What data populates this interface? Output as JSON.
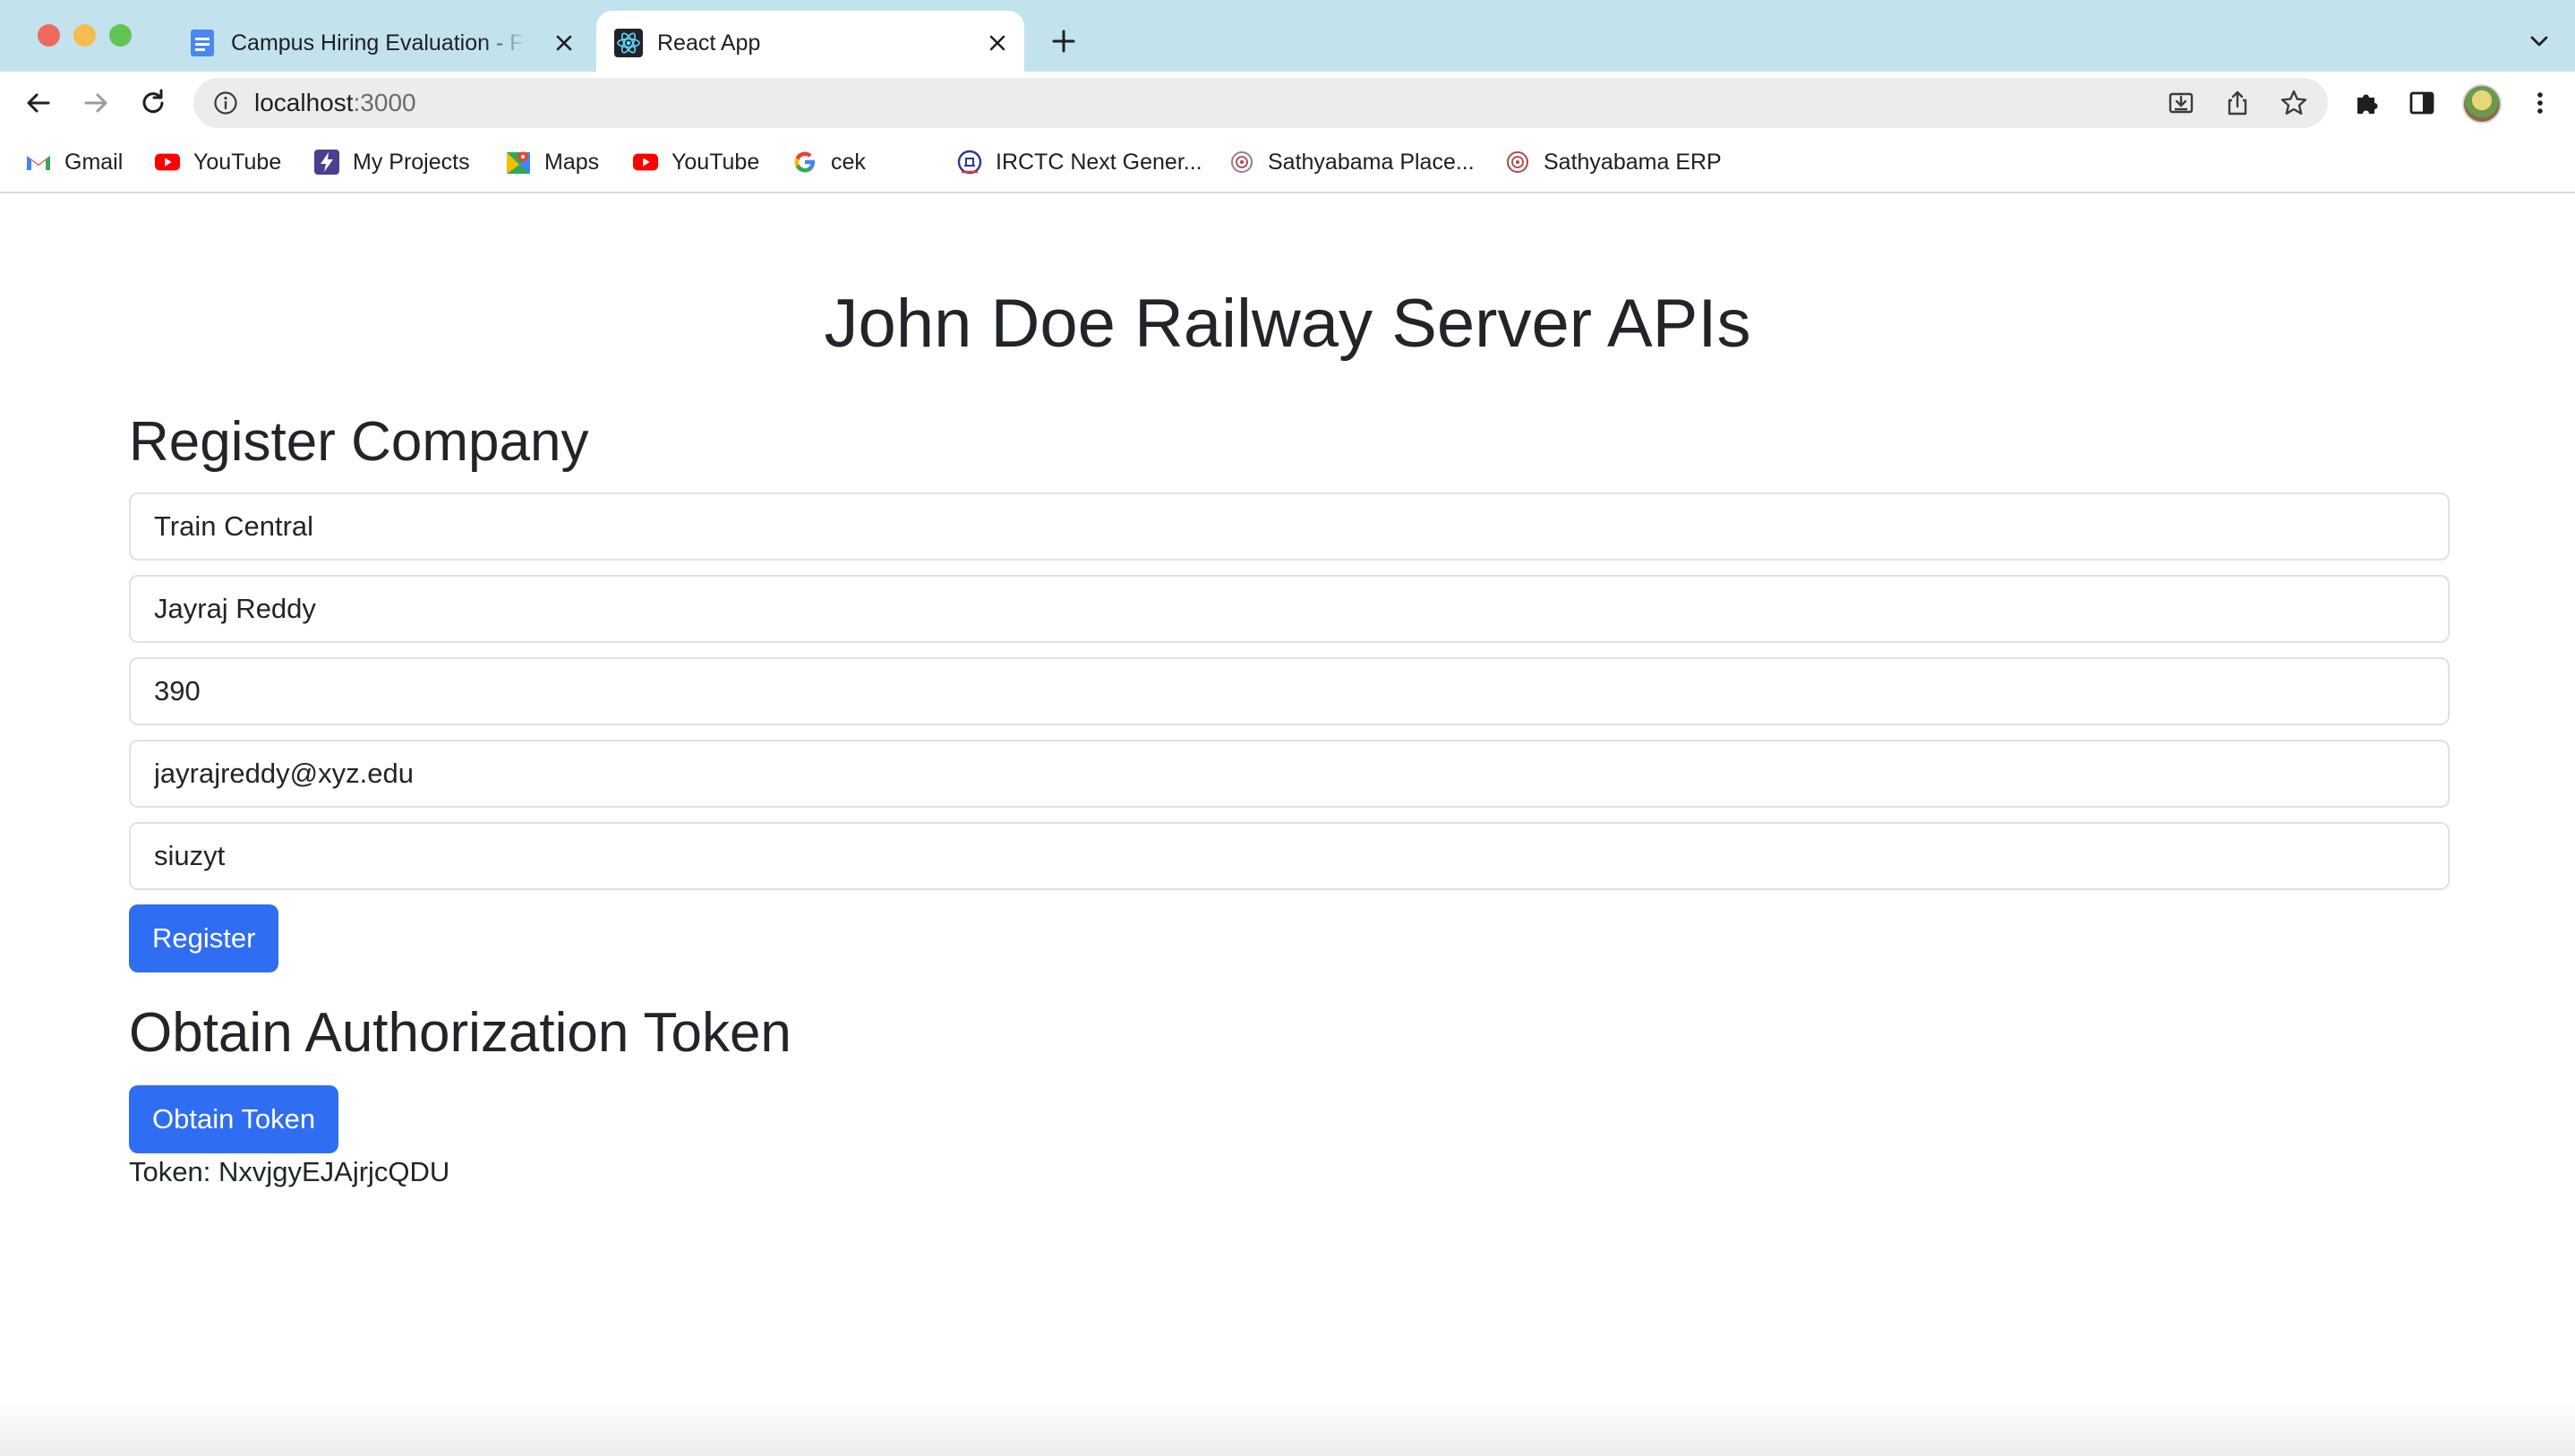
{
  "browser": {
    "tabs": [
      {
        "title": "Campus Hiring Evaluation - Full",
        "icon": "google-docs-icon",
        "active": false
      },
      {
        "title": "React App",
        "icon": "react-logo-icon",
        "active": true
      }
    ],
    "address_bar": {
      "host": "localhost",
      "port": ":3000"
    },
    "bookmarks": [
      {
        "label": "Gmail",
        "icon": "gmail-icon"
      },
      {
        "label": "YouTube",
        "icon": "youtube-icon"
      },
      {
        "label": "My Projects",
        "icon": "bolt-icon"
      },
      {
        "label": "Maps",
        "icon": "maps-icon"
      },
      {
        "label": "YouTube",
        "icon": "youtube-icon"
      },
      {
        "label": "cek",
        "icon": "google-icon"
      },
      {
        "label": "IRCTC Next Gener...",
        "icon": "irctc-icon"
      },
      {
        "label": "Sathyabama Place...",
        "icon": "sathyabama-icon"
      },
      {
        "label": "Sathyabama ERP",
        "icon": "sathyabama-icon"
      }
    ]
  },
  "page": {
    "title": "John Doe Railway Server APIs",
    "register": {
      "heading": "Register Company",
      "fields": [
        {
          "value": "Train Central"
        },
        {
          "value": "Jayraj Reddy"
        },
        {
          "value": "390"
        },
        {
          "value": "jayrajreddy@xyz.edu"
        },
        {
          "value": "siuzyt"
        }
      ],
      "button_label": "Register"
    },
    "token": {
      "heading": "Obtain Authorization Token",
      "button_label": "Obtain Token",
      "label": "Token:",
      "value": "NxvjgyEJAjrjcQDU"
    }
  },
  "colors": {
    "tabstrip": "#c2e3ee",
    "primary_button": "#2f6ef2",
    "text": "#212529"
  }
}
